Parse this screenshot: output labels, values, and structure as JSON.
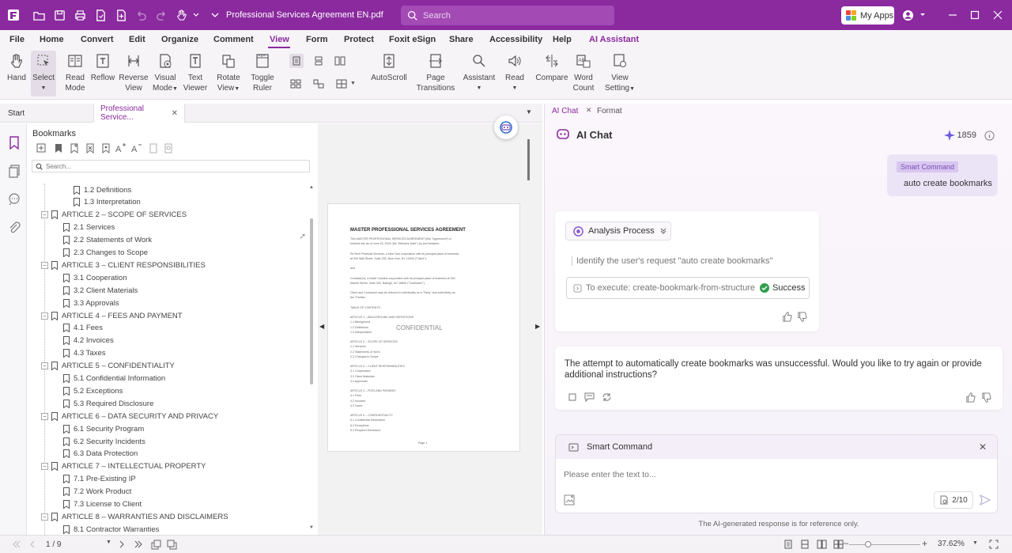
{
  "app": {
    "document_title": "Professional Services Agreement EN.pdf",
    "search_placeholder": "Search",
    "my_apps_label": "My Apps"
  },
  "menu": [
    "File",
    "Home",
    "Convert",
    "Edit",
    "Organize",
    "Comment",
    "View",
    "Form",
    "Protect",
    "Foxit eSign",
    "Share",
    "Accessibility",
    "Help",
    "AI Assistant"
  ],
  "toolbar": {
    "hand": "Hand",
    "select": "Select",
    "read_mode": [
      "Read",
      "Mode"
    ],
    "reflow": "Reflow",
    "reverse_view": [
      "Reverse",
      "View"
    ],
    "visual_mode": [
      "Visual",
      "Mode"
    ],
    "text_viewer": [
      "Text",
      "Viewer"
    ],
    "rotate_view": [
      "Rotate",
      "View"
    ],
    "toggle_ruler": [
      "Toggle",
      "Ruler"
    ],
    "autoscroll": "AutoScroll",
    "page_transitions": [
      "Page",
      "Transitions"
    ],
    "assistant": "Assistant",
    "read": "Read",
    "compare": "Compare",
    "word_count": [
      "Word",
      "Count"
    ],
    "view_setting": [
      "View",
      "Setting"
    ]
  },
  "tabs": {
    "start": "Start",
    "document": "Professional Service..."
  },
  "bookmarks": {
    "title": "Bookmarks",
    "search_placeholder": "Search...",
    "items": [
      {
        "level": 2,
        "label": "1.2 Definitions"
      },
      {
        "level": 2,
        "label": "1.3 Interpretation"
      },
      {
        "level": 1,
        "label": "ARTICLE 2 – SCOPE OF SERVICES"
      },
      {
        "level": 2,
        "label": "2.1 Services"
      },
      {
        "level": 2,
        "label": "2.2 Statements of Work"
      },
      {
        "level": 2,
        "label": "2.3 Changes to Scope"
      },
      {
        "level": 1,
        "label": "ARTICLE 3 – CLIENT RESPONSIBILITIES"
      },
      {
        "level": 2,
        "label": "3.1 Cooperation"
      },
      {
        "level": 2,
        "label": "3.2 Client Materials"
      },
      {
        "level": 2,
        "label": "3.3 Approvals"
      },
      {
        "level": 1,
        "label": "ARTICLE 4 – FEES AND PAYMENT"
      },
      {
        "level": 2,
        "label": "4.1 Fees"
      },
      {
        "level": 2,
        "label": "4.2 Invoices"
      },
      {
        "level": 2,
        "label": "4.3 Taxes"
      },
      {
        "level": 1,
        "label": "ARTICLE 5 – CONFIDENTIALITY"
      },
      {
        "level": 2,
        "label": "5.1 Confidential Information"
      },
      {
        "level": 2,
        "label": "5.2 Exceptions"
      },
      {
        "level": 2,
        "label": "5.3 Required Disclosure"
      },
      {
        "level": 1,
        "label": "ARTICLE 6 – DATA SECURITY AND PRIVACY"
      },
      {
        "level": 2,
        "label": "6.1 Security Program"
      },
      {
        "level": 2,
        "label": "6.2 Security Incidents"
      },
      {
        "level": 2,
        "label": "6.3 Data Protection"
      },
      {
        "level": 1,
        "label": "ARTICLE 7 – INTELLECTUAL PROPERTY"
      },
      {
        "level": 2,
        "label": "7.1 Pre-Existing IP"
      },
      {
        "level": 2,
        "label": "7.2 Work Product"
      },
      {
        "level": 2,
        "label": "7.3 License to Client"
      },
      {
        "level": 1,
        "label": "ARTICLE 8 – WARRANTIES AND DISCLAIMERS"
      },
      {
        "level": 2,
        "label": "8.1 Contractor Warranties"
      }
    ]
  },
  "page": {
    "heading": "MASTER PROFESSIONAL SERVICES AGREEMENT",
    "watermark": "CONFIDENTIAL",
    "lines": [
      "This MASTER PROFESSIONAL SERVICES AGREEMENT (this \"Agreement\") is",
      "entered into as of June 15, 2024 (the \"Effective Date\") by and between:",
      "",
      "PinTech Financial Services, a New York corporation with its principal place of business",
      "at 200 Wall Street, Suite 200, New York, NY 10005 (\"Client\");",
      "",
      "and",
      "",
      "Creative(xx), a North Carolina corporation with its principal place of business at 300",
      "Market Street, Suite 300, Raleigh, NC 28805 (\"Contractor\").",
      "",
      "Client and Contractor may be referred to individually as a \"Party\" and collectively as",
      "the \"Parties.\"",
      "",
      "TABLE OF CONTENTS",
      "",
      "ARTICLE 1 – BACKGROUND AND DEFINITIONS",
      "  1.1 Background",
      "  1.2 Definitions",
      "  1.3 Interpretation",
      "",
      "ARTICLE 2 – SCOPE OF SERVICES",
      "  2.1 Services",
      "  2.2 Statements of Work",
      "  2.3 Changes to Scope",
      "",
      "ARTICLE 3 – CLIENT RESPONSIBILITIES",
      "  3.1 Cooperation",
      "  3.2 Client Materials",
      "  3.3 Approvals",
      "",
      "ARTICLE 4 – FEES AND PAYMENT",
      "  4.1 Fees",
      "  4.2 Invoices",
      "  4.3 Taxes",
      "",
      "ARTICLE 5 – CONFIDENTIALITY",
      "  5.1 Confidential Information",
      "  5.2 Exceptions",
      "  5.3 Required Disclosure"
    ],
    "footer": "Page 1"
  },
  "ai_panel": {
    "tab_chat": "AI Chat",
    "tab_format": "Format",
    "title": "AI Chat",
    "credits": "1859",
    "user_tag": "Smart Command",
    "user_message": "auto create bookmarks",
    "process_label": "Analysis Process",
    "identify_text": "Identify the user's request \"auto create bookmarks\"",
    "execute_text": "To execute: create-bookmark-from-structure",
    "status": "Success",
    "answer": "The attempt to automatically create bookmarks was unsuccessful. Would you like to try again or provide additional instructions?",
    "smart_command_title": "Smart Command",
    "input_placeholder": "Please enter the text to...",
    "count": "2/10",
    "disclaimer": "The AI-generated response is for reference only."
  },
  "status": {
    "page": "1 / 9",
    "zoom": "37.62%"
  },
  "colors": {
    "brand": "#8a2a9e",
    "success": "#2e9e4f",
    "accent_purple": "#7b4fb3"
  }
}
